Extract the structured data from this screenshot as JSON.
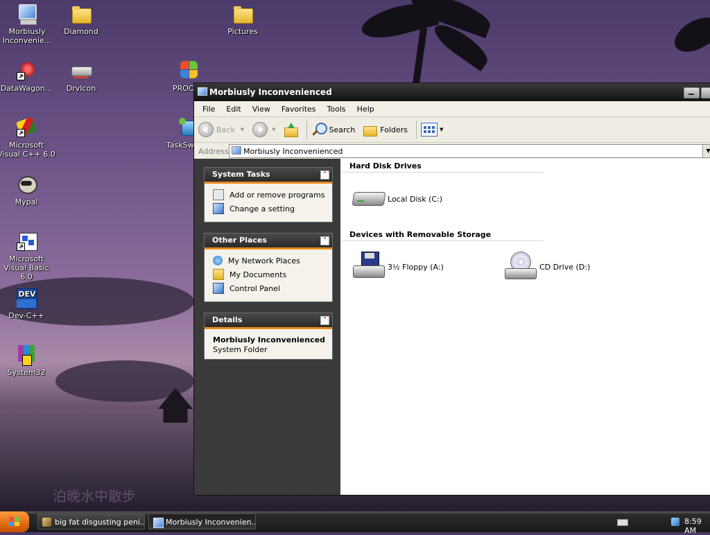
{
  "desktop": {
    "icons": [
      {
        "label": "Morbiusly Inconvenie...",
        "icon": "computer-icon"
      },
      {
        "label": "Diamond",
        "icon": "folder-icon"
      },
      {
        "label": "Pictures",
        "icon": "folder-icon"
      },
      {
        "label": "DataWagon...",
        "icon": "datawagon-shortcut-icon"
      },
      {
        "label": "DrvIcon",
        "icon": "drive-icon"
      },
      {
        "label": "PROC",
        "icon": "proc-shortcut-icon"
      },
      {
        "label": "Microsoft Visual C++ 6.0",
        "icon": "visual-cpp-icon"
      },
      {
        "label": "TaskSw",
        "icon": "taskswitch-icon"
      },
      {
        "label": "Mypal",
        "icon": "mypal-icon"
      },
      {
        "label": "Microsoft Visual Basic 6.0",
        "icon": "visual-basic-icon"
      },
      {
        "label": "Dev-C++",
        "icon": "devcpp-icon"
      },
      {
        "label": "System32",
        "icon": "archive-icon"
      }
    ],
    "watermark": "泊晚水中散步"
  },
  "window": {
    "title": "Morbiusly Inconvenienced",
    "menu": [
      "File",
      "Edit",
      "View",
      "Favorites",
      "Tools",
      "Help"
    ],
    "toolbar": {
      "back": "Back",
      "search": "Search",
      "folders": "Folders"
    },
    "address": {
      "label": "Address",
      "value": "Morbiusly Inconvenienced"
    },
    "system_tasks": {
      "title": "System Tasks",
      "items": [
        "Add or remove programs",
        "Change a setting"
      ]
    },
    "other_places": {
      "title": "Other Places",
      "items": [
        "My Network Places",
        "My Documents",
        "Control Panel"
      ]
    },
    "details": {
      "title": "Details",
      "name": "Morbiusly Inconvenienced",
      "type": "System Folder"
    },
    "groups": {
      "hdd": "Hard Disk Drives",
      "removable": "Devices with Removable Storage"
    },
    "drives": {
      "local": "Local Disk (C:)",
      "floppy": "3½ Floppy (A:)",
      "cd": "CD Drive (D:)"
    }
  },
  "taskbar": {
    "buttons": [
      "big fat disgusting peni...",
      "Morbiusly Inconvenien..."
    ],
    "clock": "8:59 AM"
  }
}
